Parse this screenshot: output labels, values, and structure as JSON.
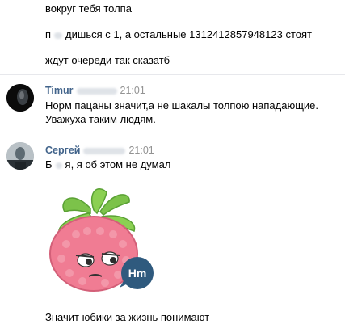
{
  "messages": {
    "line1": "вокруг тебя толпа",
    "line2_a": "п",
    "line2_b": "дишься с 1, а остальные 1312412857948123 стоят",
    "line3": "ждут очереди так сказатб",
    "timur": {
      "author": "Timur",
      "time": "21:01",
      "text1": "Норм пацаны значит,а не шакалы толпою нападающие.",
      "text2": "Уважуха таким людям."
    },
    "sergey": {
      "author": "Сергей",
      "time": "21:01",
      "text_a": "Б",
      "text_b": "я, я об этом не думал",
      "sticker_bubble": "Hm",
      "last": "Значит юбики за жизнь понимают"
    }
  },
  "colors": {
    "author": "#42648b",
    "time": "#939393",
    "separator": "#e7e8ec",
    "sticker_body": "#f07c93",
    "sticker_leaves": "#7cc24a",
    "bubble": "#2f5a7e"
  }
}
